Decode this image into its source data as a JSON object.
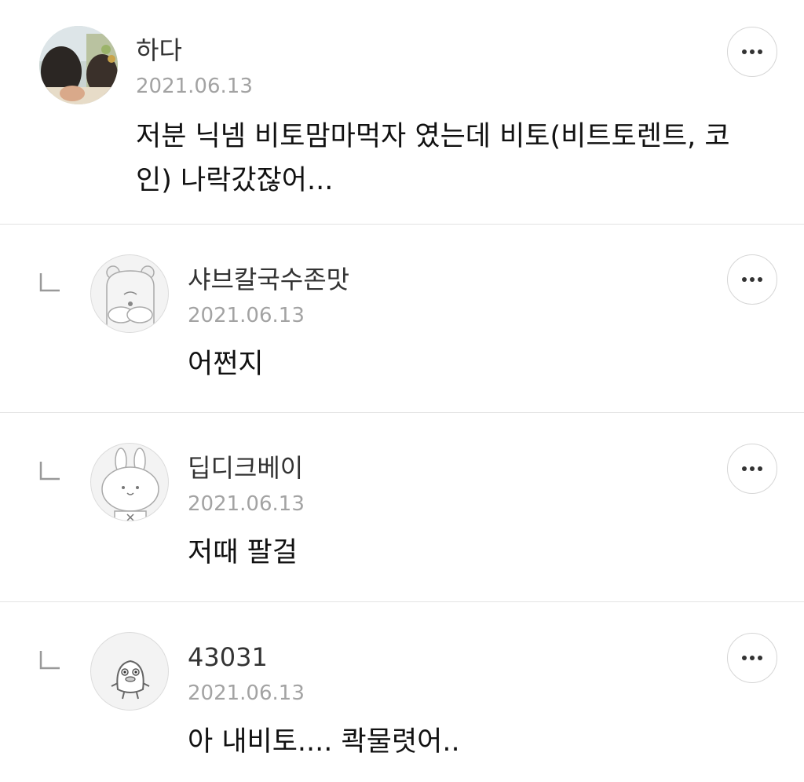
{
  "comments": [
    {
      "author": "하다",
      "date": "2021.06.13",
      "body_line1": "저분 닉넴 비토맘마먹자 였는데 비토(비트토렌트, 코",
      "body_line2": "인) 나락갔잖어...",
      "avatar_icon": "profile-photo",
      "is_reply": false
    },
    {
      "author": "샤브칼국수존맛",
      "date": "2021.06.13",
      "body": "어쩐지",
      "avatar_icon": "hamster-character-icon",
      "is_reply": true
    },
    {
      "author": "딥디크베이",
      "date": "2021.06.13",
      "body": "저때 팔걸",
      "avatar_icon": "bunny-character-icon",
      "is_reply": true
    },
    {
      "author": "43031",
      "date": "2021.06.13",
      "body": "아 내비토.... 콱물렷어..",
      "avatar_icon": "duck-character-icon",
      "is_reply": true
    }
  ],
  "more_button_icon": "more-dots-icon",
  "reply_indicator_icon": "reply-arrow-icon"
}
